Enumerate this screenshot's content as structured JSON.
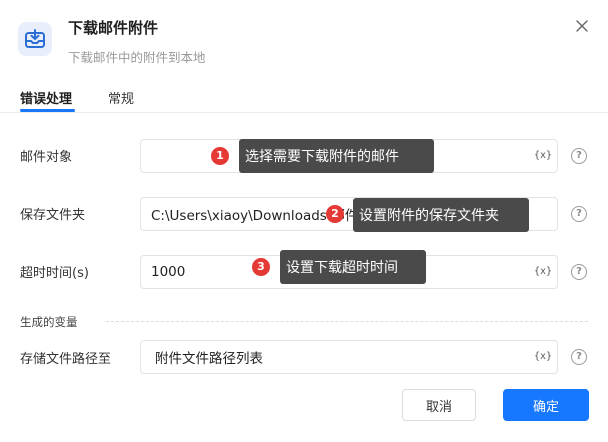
{
  "dialog": {
    "title": "下载邮件附件",
    "subtitle": "下载邮件中的附件到本地"
  },
  "tabs": [
    {
      "label": "错误处理",
      "active": true
    },
    {
      "label": "常规",
      "active": false
    }
  ],
  "fields": {
    "mail_object": {
      "label": "邮件对象",
      "value": ""
    },
    "save_folder": {
      "label": "保存文件夹",
      "value": "C:\\Users\\xiaoy\\Downloads\\邮件附件",
      "visible_tail": "地"
    },
    "timeout": {
      "label": "超时时间(s)",
      "value": "1000"
    }
  },
  "section": {
    "generated_vars_label": "生成的变量"
  },
  "output": {
    "label": "存储文件路径至",
    "value": "附件文件路径列表"
  },
  "var_button_label": "{x}",
  "help_glyph": "?",
  "tooltips": [
    {
      "badge": "1",
      "text": "选择需要下载附件的邮件"
    },
    {
      "badge": "2",
      "text": "设置附件的保存文件夹"
    },
    {
      "badge": "3",
      "text": "设置下载超时时间"
    }
  ],
  "buttons": {
    "cancel": "取消",
    "ok": "确定"
  },
  "colors": {
    "accent": "#1677ff",
    "tooltip_bg": "#4a4a4a",
    "badge": "#e53935",
    "icon_bg": "#e8eefb"
  },
  "icons": {
    "app": "download-tray-icon",
    "close": "close-icon",
    "help": "help-circle-icon",
    "variable": "variable-icon"
  }
}
